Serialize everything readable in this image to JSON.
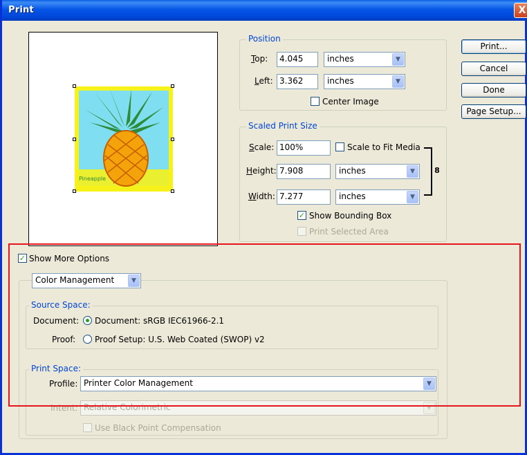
{
  "window": {
    "title": "Print",
    "close_glyph": "X"
  },
  "preview": {
    "artwork_text": "Pineapple"
  },
  "position": {
    "legend": "Position",
    "top_label": "Top:",
    "top_value": "4.045",
    "top_unit": "inches",
    "left_label": "Left:",
    "left_value": "3.362",
    "left_unit": "inches",
    "center_image_label": "Center Image",
    "center_image_checked": false
  },
  "scaled": {
    "legend": "Scaled Print Size",
    "scale_label": "Scale:",
    "scale_value": "100%",
    "scale_to_fit_label": "Scale to Fit Media",
    "height_label": "Height:",
    "height_value": "7.908",
    "height_unit": "inches",
    "width_label": "Width:",
    "width_value": "7.277",
    "width_unit": "inches",
    "show_bounding_box_label": "Show Bounding Box",
    "show_bounding_box_checked": true,
    "print_selected_area_label": "Print Selected Area"
  },
  "buttons": {
    "print": "Print...",
    "cancel": "Cancel",
    "done": "Done",
    "page_setup": "Page Setup..."
  },
  "more_options": {
    "show_more_label": "Show More Options",
    "checked": true,
    "mode_select": "Color Management"
  },
  "source_space": {
    "legend": "Source Space:",
    "document_label": "Document:",
    "document_option": "Document:  sRGB IEC61966-2.1",
    "proof_label": "Proof:",
    "proof_option": "Proof Setup:  U.S. Web Coated (SWOP) v2"
  },
  "print_space": {
    "legend": "Print Space:",
    "profile_label": "Profile:",
    "profile_value": "Printer Color Management",
    "intent_label": "Intent:",
    "intent_value": "Relative Colorimetric",
    "black_point_label": "Use Black Point Compensation"
  },
  "colors": {
    "highlight_box": "#e8141c",
    "legend_blue": "#0046d5",
    "check_green": "#21a121"
  }
}
